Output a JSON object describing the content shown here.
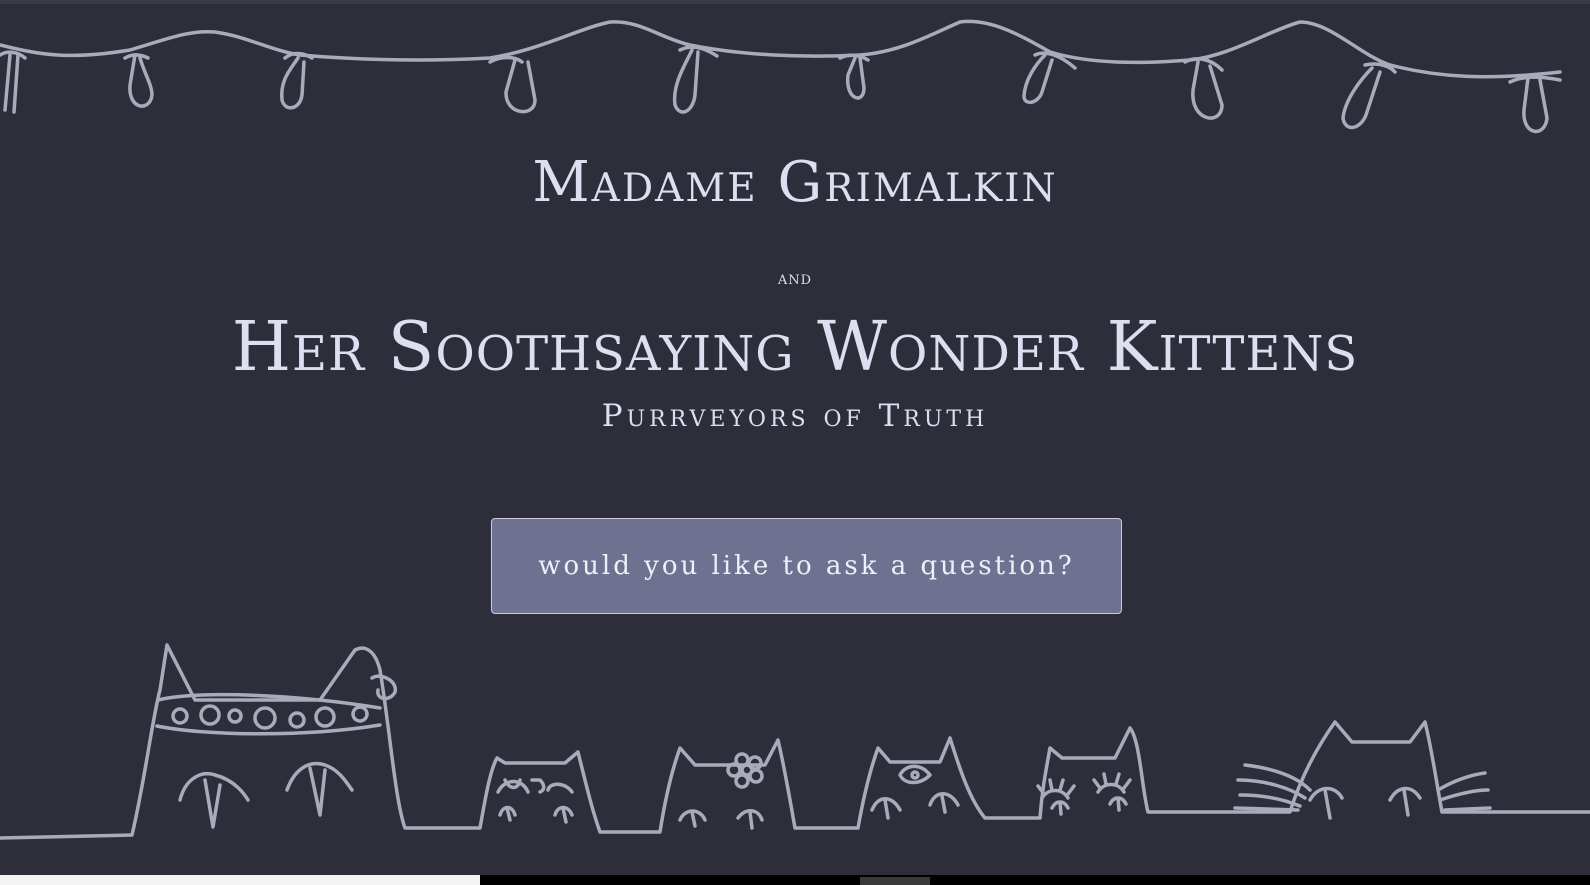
{
  "header": {
    "title_line1": "Madame Grimalkin",
    "title_and": "and",
    "title_line2": "Her Soothsaying Wonder Kittens",
    "tagline": "Purrveyors of Truth"
  },
  "cta": {
    "label": "would you like to ask a question?"
  },
  "colors": {
    "background": "#2e2e3b",
    "line_art": "#a9abbb",
    "button_fill": "#6e7290",
    "text": "#dcdff0"
  },
  "decorations": {
    "top": "string-lights-icon",
    "bottom": "peeking-cats-illustration"
  }
}
